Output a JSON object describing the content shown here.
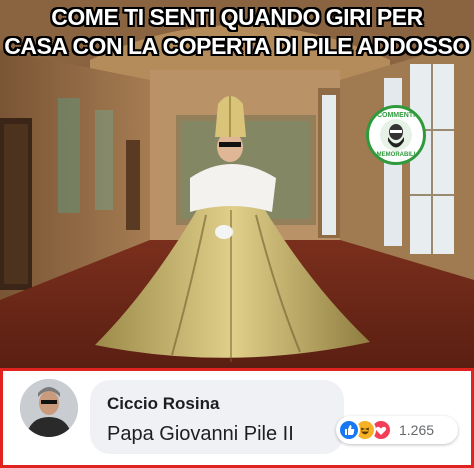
{
  "meme": {
    "caption_line1": "COME TI SENTI QUANDO GIRI PER",
    "caption_line2": "CASA CON LA COPERTA DI PILE ADDOSSO",
    "badge_top": "COMMENTI",
    "badge_bottom": "MEMORABILI",
    "badge_color": "#2f9a3c"
  },
  "comment": {
    "author": "Ciccio Rosina",
    "text": "Papa Giovanni Pile II",
    "reactions": [
      "like-icon",
      "haha-icon",
      "love-icon"
    ],
    "reaction_count": "1.265",
    "highlight_border_color": "#e0231e"
  }
}
